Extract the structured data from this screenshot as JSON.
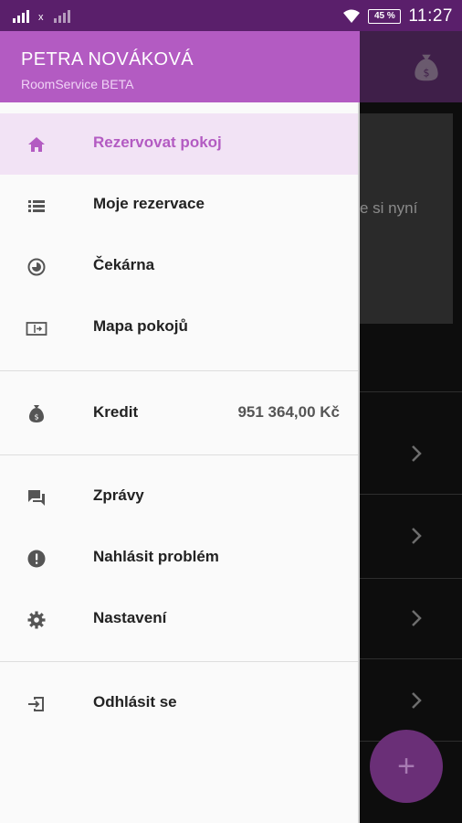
{
  "status_bar": {
    "time": "11:27",
    "battery": "45 %",
    "signal_label": "x"
  },
  "drawer": {
    "header": {
      "name": "PETRA NOVÁKOVÁ",
      "subtitle": "RoomService BETA"
    },
    "items": [
      {
        "label": "Rezervovat pokoj",
        "icon": "home-icon",
        "active": true
      },
      {
        "label": "Moje rezervace",
        "icon": "list-icon"
      },
      {
        "label": "Čekárna",
        "icon": "clock-icon"
      },
      {
        "label": "Mapa pokojů",
        "icon": "map-icon"
      },
      {
        "label": "Kredit",
        "value": "951 364,00 Kč",
        "icon": "money-bag-icon"
      },
      {
        "label": "Zprávy",
        "icon": "chat-icon"
      },
      {
        "label": "Nahlásit problém",
        "icon": "alert-icon"
      },
      {
        "label": "Nastavení",
        "icon": "gear-icon"
      },
      {
        "label": "Odhlásit se",
        "icon": "logout-icon"
      }
    ]
  },
  "background": {
    "card_text": "e si nyní",
    "fab_label": "+"
  },
  "colors": {
    "accent": "#b35bc2",
    "status_bar": "#5a1f6b",
    "active_bg": "#f2e3f5"
  }
}
